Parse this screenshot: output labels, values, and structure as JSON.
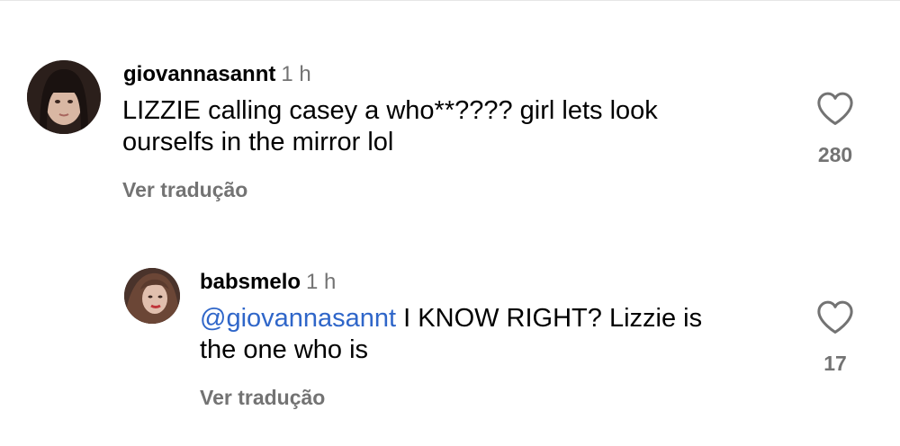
{
  "comments": [
    {
      "username": "giovannasannt",
      "time": "1 h",
      "avatar": "avatar-icon",
      "text_line_1": "LIZZIE calling casey a who**???? girl lets look",
      "text_line_2": "ourselfs in the mirror lol",
      "translate_label": "Ver tradução",
      "likes": "280",
      "like_icon": "heart-outline-icon"
    },
    {
      "username": "babsmelo",
      "time": "1 h",
      "avatar": "avatar-icon",
      "mention": "@giovannasannt",
      "text_line_1_rest": " I KNOW RIGHT? Lizzie is",
      "text_line_2": "the one who is",
      "translate_label": "Ver tradução",
      "likes": "17",
      "like_icon": "heart-outline-icon"
    }
  ],
  "colors": {
    "mention": "#2f66c9",
    "secondary_text": "#737373",
    "primary_text": "#000000"
  }
}
